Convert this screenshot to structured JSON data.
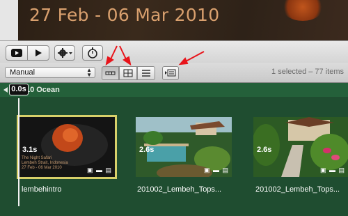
{
  "preview": {
    "date_range": "27 Feb - 06 Mar 2010"
  },
  "toolbar": {
    "play_icon": "play-icon",
    "play_full_icon": "play-fullscreen-icon",
    "action_icon": "gear-icon",
    "stopwatch_icon": "stopwatch-icon"
  },
  "filter": {
    "selected": "Manual"
  },
  "view_modes": [
    "filmstrip",
    "grid",
    "list"
  ],
  "status": "1 selected – 77 items",
  "event": {
    "title": ".8 - 10 Ocean"
  },
  "playhead": {
    "time": "0.0s"
  },
  "clips": [
    {
      "name": "lembehintro",
      "duration": "3.1s",
      "thumb_text": [
        "The Night Safari",
        "Lembeh Strait, Indonesia",
        "27 Feb - 06 Mar 2010"
      ]
    },
    {
      "name": "201002_Lembeh_Tops...",
      "duration": "2.6s"
    },
    {
      "name": "201002_Lembeh_Tops...",
      "duration": "2.6s"
    }
  ],
  "colors": {
    "accent_arrow": "#e8141b",
    "event_bg": "#1f4d30",
    "selection": "#d8d06a"
  }
}
